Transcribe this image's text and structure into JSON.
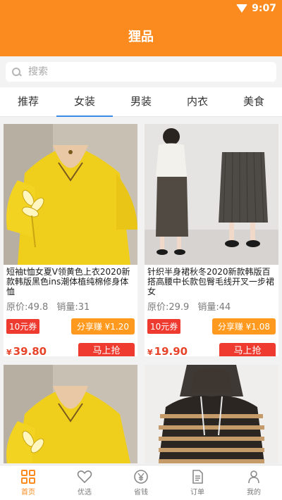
{
  "status": {
    "time": "9:07"
  },
  "header": {
    "title": "狸品"
  },
  "search": {
    "placeholder": "搜索"
  },
  "tabs": [
    {
      "label": "推荐"
    },
    {
      "label": "女装"
    },
    {
      "label": "男装"
    },
    {
      "label": "内衣"
    },
    {
      "label": "美食"
    }
  ],
  "products": [
    {
      "name": "短袖t恤女夏V领黄色上衣2020新款韩版黑色ins潮体植纯棉修身体恤",
      "original_price": "原价:49.8",
      "sales": "销量:31",
      "coupon": "10元券",
      "share": "分享赚 ¥1.20",
      "price_symbol": "¥",
      "price": "39.80",
      "buy": "马上抢"
    },
    {
      "name": "针织半身裙秋冬2020新款韩版百搭高腰中长款包臀毛线开叉一步裙女",
      "original_price": "原价:29.9",
      "sales": "销量:44",
      "coupon": "10元券",
      "share": "分享赚 ¥1.08",
      "price_symbol": "¥",
      "price": "19.90",
      "buy": "马上抢"
    }
  ],
  "bottom_nav": [
    {
      "label": "首页",
      "icon": "home-grid-icon"
    },
    {
      "label": "优选",
      "icon": "heart-icon"
    },
    {
      "label": "省钱",
      "icon": "yen-coin-icon"
    },
    {
      "label": "订单",
      "icon": "document-icon"
    },
    {
      "label": "我的",
      "icon": "person-icon"
    }
  ],
  "colors": {
    "accent": "#fb8b1f",
    "red": "#ef3b2f",
    "tab_indicator": "#3a8be8"
  }
}
